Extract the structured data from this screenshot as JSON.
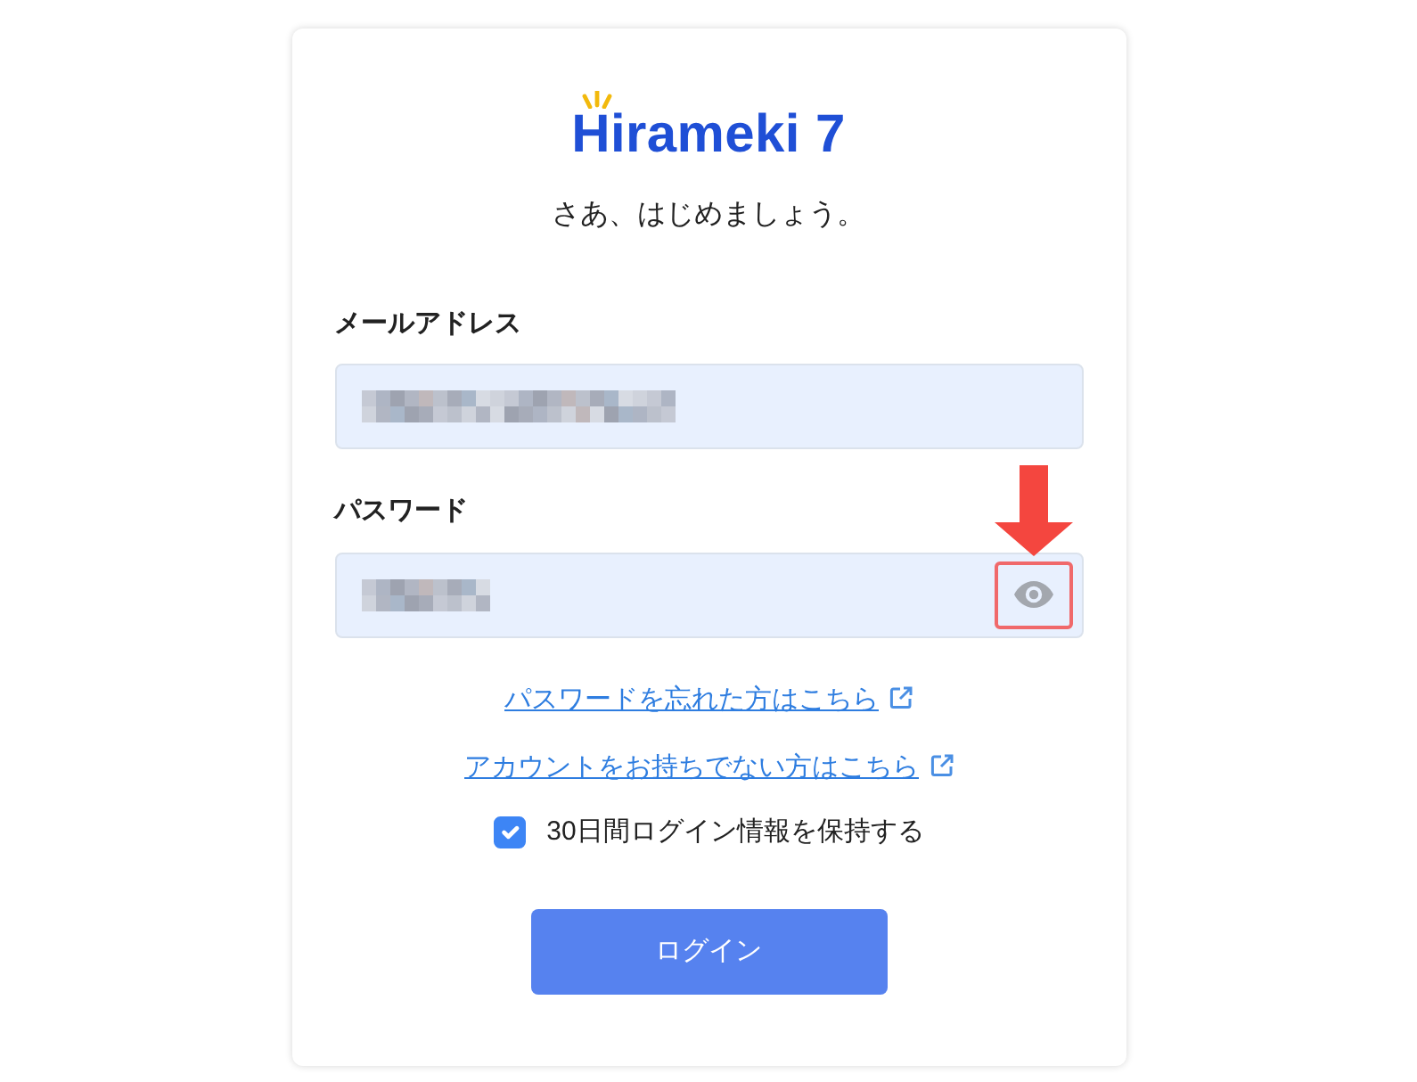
{
  "logo": {
    "text": "Hirameki 7"
  },
  "subtitle": "さあ、はじめましょう。",
  "fields": [
    {
      "kind": "email",
      "label": "メールアドレス",
      "value_pixelated": true
    },
    {
      "kind": "password",
      "label": "パスワード",
      "value_pixelated": true,
      "toggle_highlighted": true
    }
  ],
  "links": [
    {
      "label": "パスワードを忘れた方はこちら",
      "external": true
    },
    {
      "label": "アカウントをお持ちでない方はこちら",
      "external": true
    }
  ],
  "remember": {
    "label": "30日間ログイン情報を保持する",
    "checked": true
  },
  "submit_button": "ログイン"
}
